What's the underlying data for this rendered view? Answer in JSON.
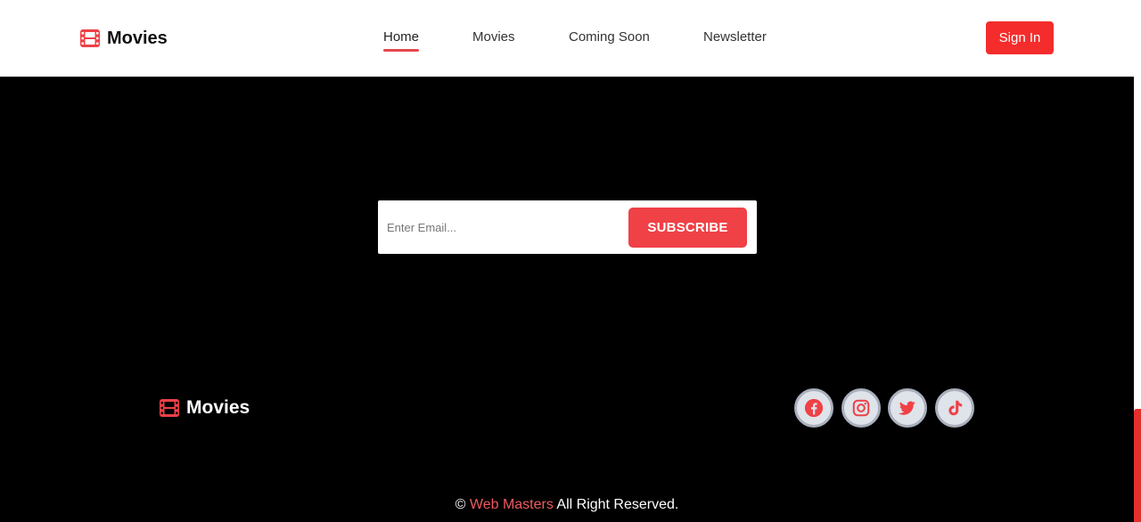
{
  "header": {
    "logo_text": "Movies",
    "logo_icon": "film-icon",
    "nav": [
      {
        "label": "Home",
        "active": true
      },
      {
        "label": "Movies",
        "active": false
      },
      {
        "label": "Coming Soon",
        "active": false
      },
      {
        "label": "Newsletter",
        "active": false
      }
    ],
    "signin_label": "Sign In"
  },
  "subscribe": {
    "email_placeholder": "Enter Email...",
    "email_value": "",
    "button_label": "SUBSCRIBE"
  },
  "footer": {
    "logo_text": "Movies",
    "social": [
      {
        "icon": "facebook-icon"
      },
      {
        "icon": "instagram-icon"
      },
      {
        "icon": "twitter-icon"
      },
      {
        "icon": "tiktok-icon"
      }
    ],
    "copyright_symbol": "©",
    "copyright_brand": "Web Masters",
    "copyright_rest": "All Right Reserved."
  },
  "colors": {
    "accent": "#f52c2c",
    "accent_soft": "#ef4146",
    "background": "#000000",
    "header_bg": "#ffffff",
    "icon_red": "#ef4146"
  }
}
